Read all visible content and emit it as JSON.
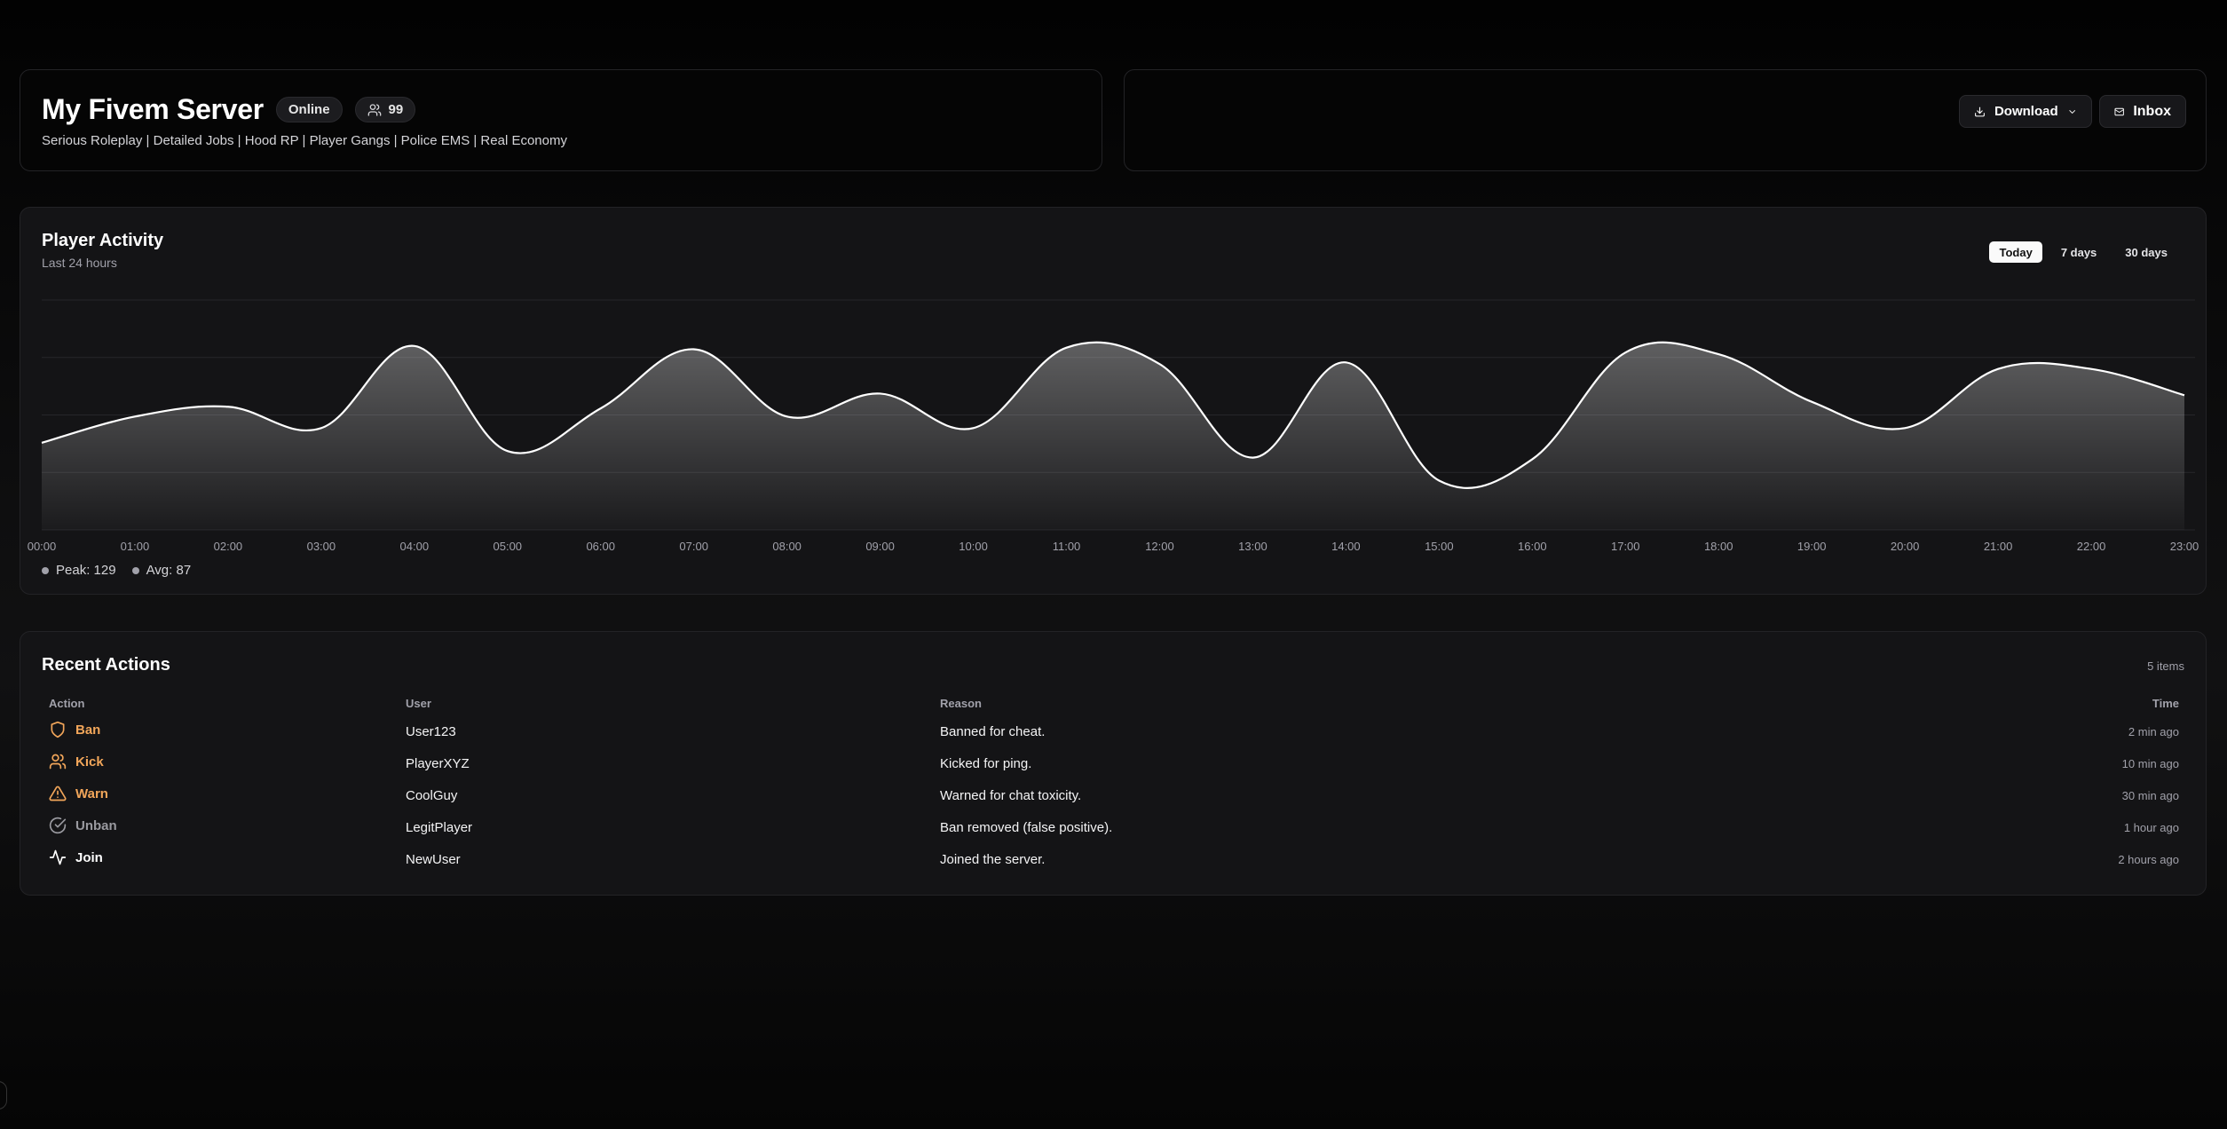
{
  "server": {
    "title": "My Fivem Server",
    "status": "Online",
    "players": "99",
    "tags": "Serious Roleplay | Detailed Jobs | Hood RP | Player Gangs | Police EMS | Real Economy"
  },
  "toolbar": {
    "download_label": "Download",
    "inbox_label": "Inbox"
  },
  "activity": {
    "title": "Player Activity",
    "subtitle": "Last 24 hours",
    "ranges": [
      "Today",
      "7 days",
      "30 days"
    ],
    "active_range": "Today",
    "peak": "Peak: 129",
    "avg": "Avg: 87"
  },
  "chart_data": {
    "type": "area",
    "x": [
      "00:00",
      "01:00",
      "02:00",
      "03:00",
      "04:00",
      "05:00",
      "06:00",
      "07:00",
      "08:00",
      "09:00",
      "10:00",
      "11:00",
      "12:00",
      "13:00",
      "14:00",
      "15:00",
      "16:00",
      "17:00",
      "18:00",
      "19:00",
      "20:00",
      "21:00",
      "22:00",
      "23:00"
    ],
    "values": [
      73,
      89,
      95,
      82,
      132,
      68,
      94,
      130,
      89,
      103,
      82,
      131,
      121,
      64,
      122,
      50,
      63,
      128,
      127,
      98,
      82,
      118,
      118,
      102
    ],
    "ylim": [
      20,
      160
    ],
    "grid": true
  },
  "recent": {
    "title": "Recent Actions",
    "count": "5 items",
    "columns": [
      "Action",
      "User",
      "Reason",
      "Time"
    ],
    "rows": [
      {
        "action": "Ban",
        "icon": "shield-icon",
        "color": "orange",
        "user": "User123",
        "reason": "Banned for cheat.",
        "time": "2 min ago"
      },
      {
        "action": "Kick",
        "icon": "users-icon",
        "color": "orange",
        "user": "PlayerXYZ",
        "reason": "Kicked for ping.",
        "time": "10 min ago"
      },
      {
        "action": "Warn",
        "icon": "warning-icon",
        "color": "orange",
        "user": "CoolGuy",
        "reason": "Warned for chat toxicity.",
        "time": "30 min ago"
      },
      {
        "action": "Unban",
        "icon": "check-circle-icon",
        "color": "gray",
        "user": "LegitPlayer",
        "reason": "Ban removed (false positive).",
        "time": "1 hour ago"
      },
      {
        "action": "Join",
        "icon": "activity-icon",
        "color": "white",
        "user": "NewUser",
        "reason": "Joined the server.",
        "time": "2 hours ago"
      }
    ]
  },
  "colors": {
    "accent_orange": "#f2a65a",
    "background": "#000000"
  }
}
